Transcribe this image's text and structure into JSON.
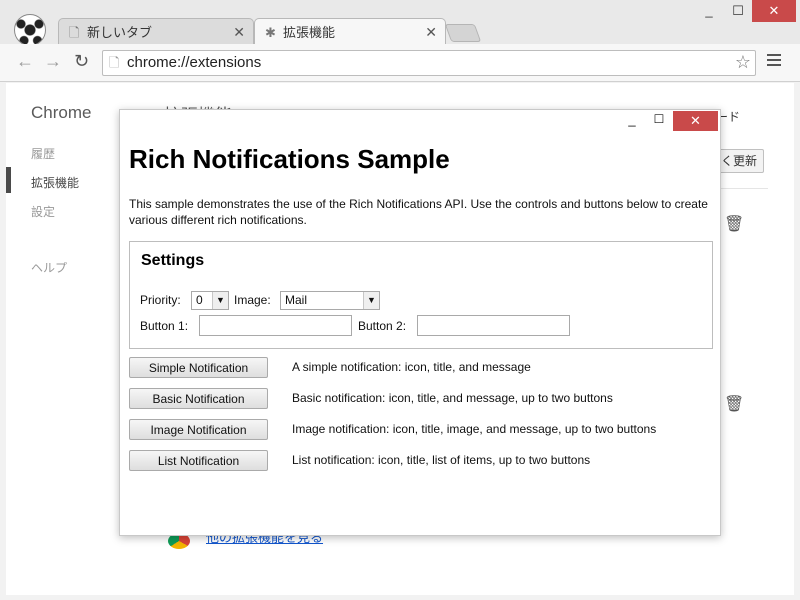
{
  "browser": {
    "tabs": [
      {
        "title": "新しいタブ",
        "icon": "page-icon"
      },
      {
        "title": "拡張機能",
        "icon": "puzzle-icon"
      }
    ],
    "address": "chrome://extensions",
    "window_controls": {
      "minimize": "_",
      "maximize": "☐",
      "close": "✕"
    }
  },
  "extensions_page": {
    "brand": "Chrome",
    "sidebar": [
      {
        "label": "履歴"
      },
      {
        "label": "拡張機能"
      },
      {
        "label": "設定"
      },
      {
        "label": "ヘルプ"
      }
    ],
    "heading": "拡張機能",
    "mode_label": "ード",
    "update_label": "く更新",
    "more_link": "他の拡張機能を見る"
  },
  "popup": {
    "window_controls": {
      "minimize": "_",
      "maximize": "☐",
      "close": "✕"
    },
    "title": "Rich Notifications Sample",
    "description": "This sample demonstrates the use of the Rich Notifications API. Use the controls and buttons below to create various different rich notifications.",
    "settings": {
      "heading": "Settings",
      "priority_label": "Priority:",
      "priority_value": "0",
      "image_label": "Image:",
      "image_value": "Mail",
      "button1_label": "Button 1:",
      "button1_value": "",
      "button2_label": "Button 2:",
      "button2_value": ""
    },
    "notifications": [
      {
        "button": "Simple Notification",
        "description": "A simple notification: icon, title, and message"
      },
      {
        "button": "Basic Notification",
        "description": "Basic notification: icon, title, and message, up to two buttons"
      },
      {
        "button": "Image Notification",
        "description": "Image notification: icon, title, image, and message, up to two buttons"
      },
      {
        "button": "List Notification",
        "description": "List notification: icon, title, list of items, up to two buttons"
      }
    ]
  },
  "colors": {
    "close_button": "#c94a4a",
    "link": "#1155cc"
  }
}
